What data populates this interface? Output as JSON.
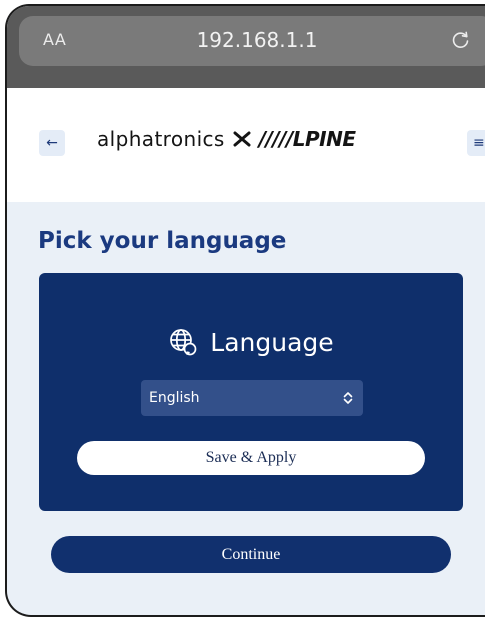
{
  "browser": {
    "text_size_label": "AA",
    "url": "192.168.1.1",
    "reload_icon": "reload-icon"
  },
  "header": {
    "back_icon": "arrow-left-icon",
    "back_glyph": "←",
    "logo_left": "alphatronics",
    "logo_separator_icon": "x-icon",
    "logo_right": "/////LPINE",
    "menu_icon": "hamburger-icon",
    "menu_glyph": "≡"
  },
  "main": {
    "title": "Pick your language",
    "card": {
      "icon": "globe-icon",
      "heading": "Language",
      "select_value": "English",
      "select_icon": "chevron-up-down-icon",
      "save_label": "Save & Apply"
    },
    "continue_label": "Continue"
  },
  "colors": {
    "primary": "#0f2f6b",
    "title": "#1b3a80",
    "page_background": "#eaf0f7",
    "browser_bar": "#5a5a5a"
  }
}
